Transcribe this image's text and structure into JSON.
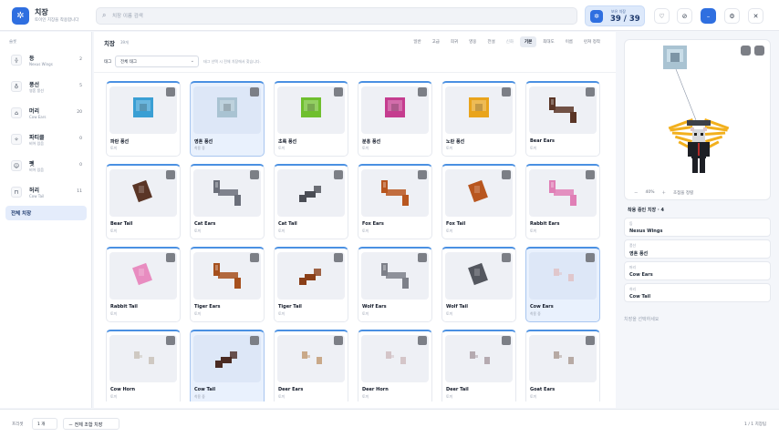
{
  "app": {
    "title": "치장",
    "subtitle": "토이인 치장을 착용합니다",
    "logo_icon": "sparkle-icon"
  },
  "search": {
    "placeholder": "치장 이름 검색"
  },
  "counter": {
    "label": "보유 치장",
    "value": "39 / 39"
  },
  "toolbar": [
    {
      "name": "shirt-icon",
      "glyph": "♡"
    },
    {
      "name": "eye-off-icon",
      "glyph": "⊘"
    },
    {
      "name": "minus-icon",
      "glyph": "–"
    },
    {
      "name": "settings-icon",
      "glyph": "⚙"
    },
    {
      "name": "close-icon",
      "glyph": "✕"
    }
  ],
  "sidebar": {
    "header": "슬롯",
    "items": [
      {
        "label": "등",
        "sub": "Nexus Wings",
        "count": "2",
        "icon": "wings-icon",
        "glyph": "⟠"
      },
      {
        "label": "풍선",
        "sub": "영혼 풍선",
        "count": "5",
        "icon": "balloon-icon",
        "glyph": "♁"
      },
      {
        "label": "머리",
        "sub": "Cow Ears",
        "count": "20",
        "icon": "head-icon",
        "glyph": "⌂"
      },
      {
        "label": "파티클",
        "sub": "비어 있음",
        "count": "0",
        "icon": "particle-icon",
        "glyph": "✧"
      },
      {
        "label": "펫",
        "sub": "비어 있음",
        "count": "0",
        "icon": "pet-icon",
        "glyph": "☺"
      },
      {
        "label": "허리",
        "sub": "Cow Tail",
        "count": "11",
        "icon": "waist-icon",
        "glyph": "⊓"
      }
    ],
    "all_label": "전체 치장"
  },
  "main": {
    "title": "치장",
    "count": "39개",
    "tabs": [
      "일반",
      "고급",
      "희귀",
      "영웅",
      "전설",
      "신화",
      "기본",
      "최대도",
      "이름",
      "런쳐 정착"
    ],
    "active_tab": 6,
    "muted_tab": 5,
    "filter_label": "태그",
    "filter_value": "전체 태그",
    "filter_hint": "태그 선택 시 전체 치장에서 찾습니다."
  },
  "cards": [
    {
      "name": "파란 풍선",
      "sub": "토끼",
      "color": "#3a9fd4",
      "shape": "balloon",
      "selected": false
    },
    {
      "name": "영혼 풍선",
      "sub": "착용 중",
      "color": "#a9c3d2",
      "shape": "balloon",
      "selected": true
    },
    {
      "name": "초록 풍선",
      "sub": "토끼",
      "color": "#6fbf2e",
      "shape": "balloon",
      "selected": false
    },
    {
      "name": "분홍 풍선",
      "sub": "토끼",
      "color": "#c53d8f",
      "shape": "balloon",
      "selected": false
    },
    {
      "name": "노란 풍선",
      "sub": "토끼",
      "color": "#e9a41c",
      "shape": "balloon",
      "selected": false
    },
    {
      "name": "Bear Ears",
      "sub": "토끼",
      "color": "#5a3526",
      "shape": "ears",
      "selected": false
    },
    {
      "name": "Bear Tail",
      "sub": "토끼",
      "color": "#5a3526",
      "shape": "blob",
      "selected": false
    },
    {
      "name": "Cat Ears",
      "sub": "토끼",
      "color": "#6b6f7a",
      "shape": "ears",
      "selected": false
    },
    {
      "name": "Cat Tail",
      "sub": "토끼",
      "color": "#4a4d55",
      "shape": "tail",
      "selected": false
    },
    {
      "name": "Fox Ears",
      "sub": "토끼",
      "color": "#b8561f",
      "shape": "ears",
      "selected": false
    },
    {
      "name": "Fox Tail",
      "sub": "토끼",
      "color": "#b8561f",
      "shape": "blob",
      "selected": false
    },
    {
      "name": "Rabbit Ears",
      "sub": "토끼",
      "color": "#e07fb6",
      "shape": "ears",
      "selected": false
    },
    {
      "name": "Rabbit Tail",
      "sub": "토끼",
      "color": "#e88cc0",
      "shape": "blob",
      "selected": false
    },
    {
      "name": "Tiger Ears",
      "sub": "토끼",
      "color": "#a6501d",
      "shape": "ears",
      "selected": false
    },
    {
      "name": "Tiger Tail",
      "sub": "토끼",
      "color": "#8a3f18",
      "shape": "tail",
      "selected": false
    },
    {
      "name": "Wolf Ears",
      "sub": "토끼",
      "color": "#7d8089",
      "shape": "ears",
      "selected": false
    },
    {
      "name": "Wolf Tail",
      "sub": "토끼",
      "color": "#54575f",
      "shape": "blob",
      "selected": false
    },
    {
      "name": "Cow Ears",
      "sub": "착용 중",
      "color": "#e0c7cc",
      "shape": "small",
      "selected": true
    },
    {
      "name": "Cow Horn",
      "sub": "토끼",
      "color": "#cfc9c2",
      "shape": "small",
      "selected": false
    },
    {
      "name": "Cow Tail",
      "sub": "착용 중",
      "color": "#4a2b22",
      "shape": "tail",
      "selected": true
    },
    {
      "name": "Deer Ears",
      "sub": "토끼",
      "color": "#c9a989",
      "shape": "small",
      "selected": false
    },
    {
      "name": "Deer Horn",
      "sub": "토끼",
      "color": "#d4c5c8",
      "shape": "small",
      "selected": false
    },
    {
      "name": "Deer Tail",
      "sub": "토끼",
      "color": "#b5aab0",
      "shape": "small",
      "selected": false
    },
    {
      "name": "Goat Ears",
      "sub": "토끼",
      "color": "#b7aaa4",
      "shape": "small",
      "selected": false
    }
  ],
  "preview": {
    "zoom": "40%",
    "reset_label": "초점을 정렬",
    "applied_title": "착용 중인 치장 · 4",
    "slots": [
      {
        "label": "등",
        "value": "Nexus Wings"
      },
      {
        "label": "풍선",
        "value": "영혼 풍선"
      },
      {
        "label": "머리",
        "value": "Cow Ears"
      },
      {
        "label": "허리",
        "value": "Cow Tail"
      }
    ],
    "hint": "치장을 선택하세요",
    "wing_color": "#f2b01e"
  },
  "footer": {
    "label": "프리셋",
    "page": "1 개",
    "button": "전체 조합 치장",
    "right": "1 / 1 치장팀"
  }
}
